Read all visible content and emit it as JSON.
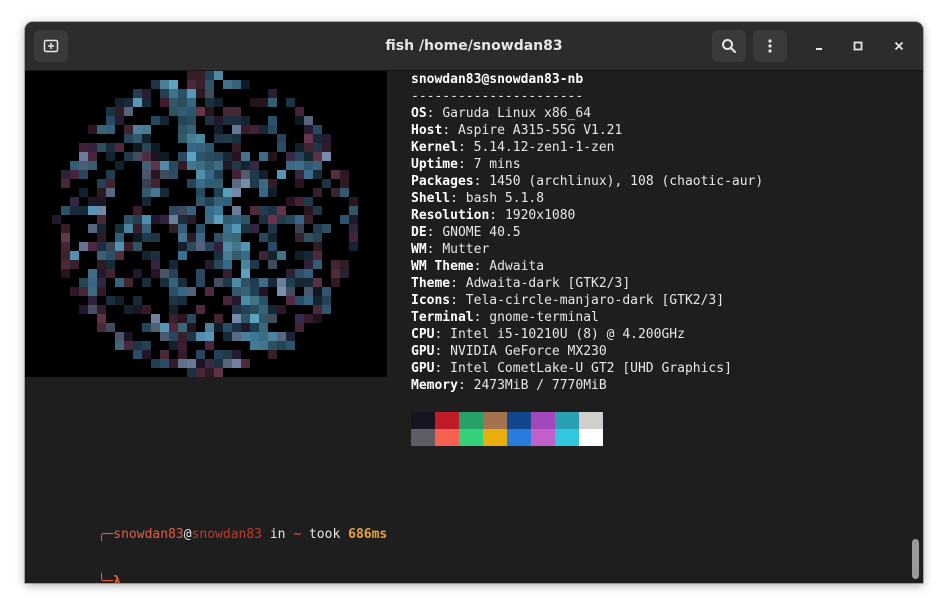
{
  "window": {
    "title": "fish /home/snowdan83"
  },
  "headerbar": {
    "new_tab_icon": "new-tab-icon",
    "search_icon": "search-icon",
    "menu_icon": "kebab-menu-icon",
    "minimize_icon": "minimize-icon",
    "maximize_icon": "maximize-icon",
    "close_icon": "close-icon"
  },
  "neofetch": {
    "user_host": "snowdan83@snowdan83-nb",
    "separator": "----------------------",
    "rows": [
      {
        "key": "OS",
        "value": "Garuda Linux x86_64"
      },
      {
        "key": "Host",
        "value": "Aspire A315-55G V1.21"
      },
      {
        "key": "Kernel",
        "value": "5.14.12-zen1-1-zen"
      },
      {
        "key": "Uptime",
        "value": "7 mins"
      },
      {
        "key": "Packages",
        "value": "1450 (archlinux), 108 (chaotic-aur)"
      },
      {
        "key": "Shell",
        "value": "bash 5.1.8"
      },
      {
        "key": "Resolution",
        "value": "1920x1080"
      },
      {
        "key": "DE",
        "value": "GNOME 40.5"
      },
      {
        "key": "WM",
        "value": "Mutter"
      },
      {
        "key": "WM Theme",
        "value": "Adwaita"
      },
      {
        "key": "Theme",
        "value": "Adwaita-dark [GTK2/3]"
      },
      {
        "key": "Icons",
        "value": "Tela-circle-manjaro-dark [GTK2/3]"
      },
      {
        "key": "Terminal",
        "value": "gnome-terminal"
      },
      {
        "key": "CPU",
        "value": "Intel i5-10210U (8) @ 4.200GHz"
      },
      {
        "key": "GPU",
        "value": "NVIDIA GeForce MX230"
      },
      {
        "key": "GPU",
        "value": "Intel CometLake-U GT2 [UHD Graphics]"
      },
      {
        "key": "Memory",
        "value": "2473MiB / 7770MiB"
      }
    ],
    "palette_row1": [
      "#171421",
      "#c01c28",
      "#26a269",
      "#a2734c",
      "#12488b",
      "#a347ba",
      "#2aa1b3",
      "#d0cfcc"
    ],
    "palette_row2": [
      "#5e5c64",
      "#f66151",
      "#33d17a",
      "#e9ad0c",
      "#2a7bde",
      "#c061cb",
      "#33c7de",
      "#ffffff"
    ]
  },
  "prompt": {
    "corner_top": "╭─",
    "user": "snowdan83",
    "at": "@",
    "host": "snowdan83",
    "in": " in ",
    "dir": "~",
    "took": " took ",
    "duration": "686ms",
    "corner_bottom": "╰─",
    "lambda": "λ",
    "cursor": "_"
  },
  "colors": {
    "prompt_corner": "#e05d44",
    "prompt_user": "#e05d44",
    "prompt_host": "#c0392b",
    "prompt_duration": "#e9a23b",
    "prompt_dir": "#e05d44"
  }
}
